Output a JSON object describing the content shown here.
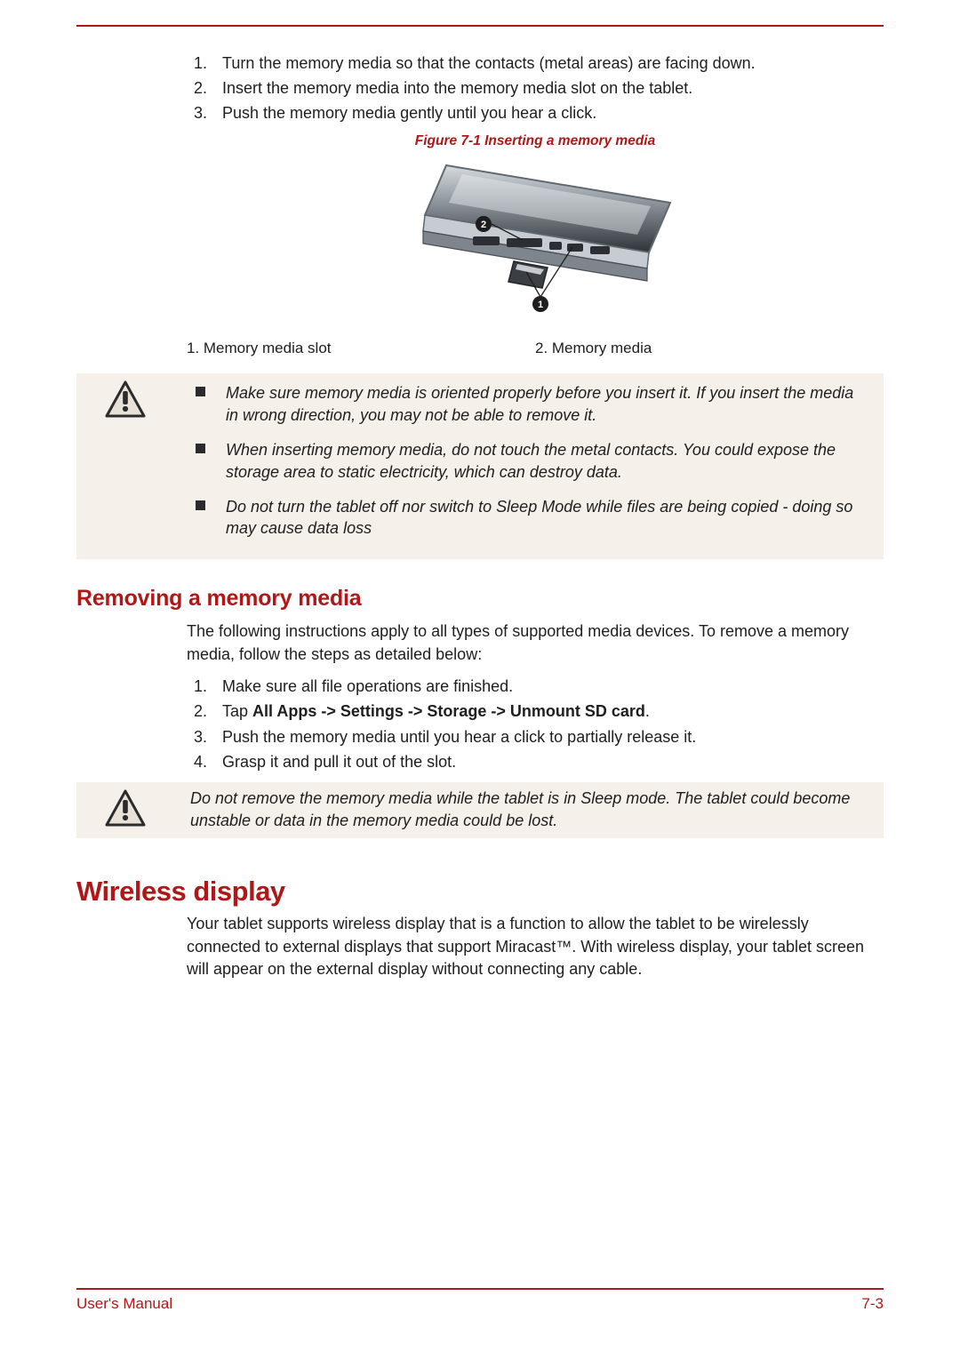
{
  "steps_insert": [
    "Turn the memory media so that the contacts (metal areas) are facing down.",
    "Insert the memory media into the memory media slot on the tablet.",
    "Push the memory media gently until you hear a click."
  ],
  "figure": {
    "caption": "Figure 7-1 Inserting a memory media",
    "key_left": "1. Memory media slot",
    "key_right": "2. Memory media"
  },
  "warn1": {
    "items": [
      "Make sure memory media is oriented properly before you insert it. If you insert the media in wrong direction, you may not be able to remove it.",
      "When inserting memory media, do not touch the metal contacts. You could expose the storage area to static electricity, which can destroy data.",
      "Do not turn the tablet off nor switch to Sleep Mode while files are being copied - doing so may cause data loss"
    ]
  },
  "heading_remove": "Removing a memory media",
  "remove_intro": "The following instructions apply to all types of supported media devices. To remove a memory media, follow the steps as detailed below:",
  "steps_remove": [
    "Make sure all file operations are finished.",
    "Tap ",
    "Push the memory media until you hear a click to partially release it.",
    "Grasp it and pull it out of the slot."
  ],
  "step2_bold": "All Apps -> Settings -> Storage -> Unmount SD card",
  "step2_tail": ".",
  "warn2": "Do not remove the memory media while the tablet is in Sleep mode. The tablet could become unstable or data in the memory media could be lost.",
  "heading_wireless": "Wireless display",
  "wireless_body": "Your tablet supports wireless display that is a function to allow the tablet to be wirelessly connected to external displays that support Miracast™. With wireless display, your tablet screen will appear on the external display without connecting any cable.",
  "footer": {
    "left": "User's Manual",
    "right": "7-3"
  }
}
